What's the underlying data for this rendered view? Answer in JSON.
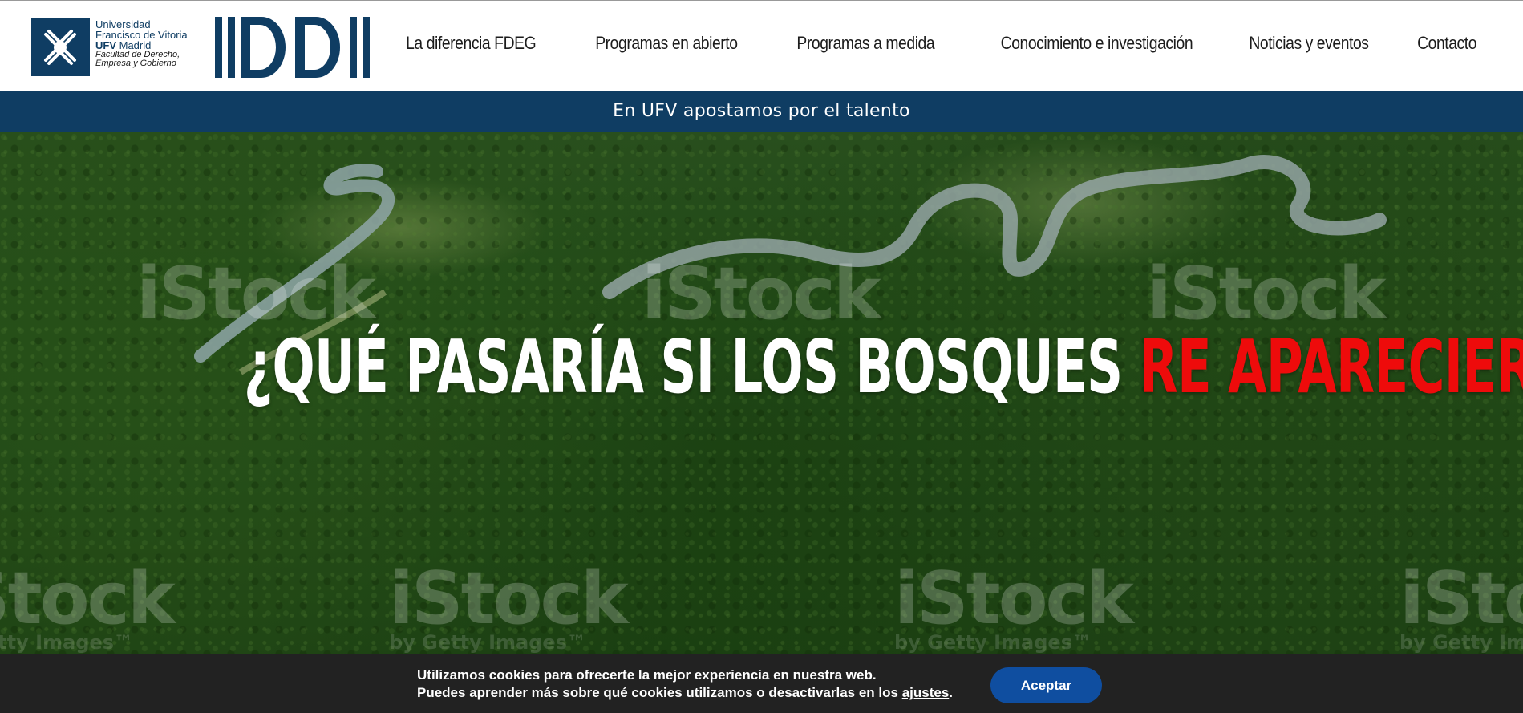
{
  "header": {
    "logo": {
      "line1": "Universidad",
      "line2": "Francisco de Vitoria",
      "line3_bold": "UFV",
      "line3_rest": " Madrid",
      "line4": "Facultad de Derecho,",
      "line5": "Empresa y Gobierno"
    },
    "nav": [
      {
        "label": "La diferencia FDEG"
      },
      {
        "label": "Programas en abierto"
      },
      {
        "label": "Programas a medida"
      },
      {
        "label": "Conocimiento e investigación"
      },
      {
        "label": "Noticias y eventos"
      },
      {
        "label": "Contacto"
      }
    ]
  },
  "banner": {
    "text": "En UFV apostamos por el talento"
  },
  "hero": {
    "title_part1": "¿QUÉ PASARÍA SI LOS BOSQUES ",
    "title_highlight": "RE APARECIERAN?",
    "watermark_text": "iStock",
    "watermark_sub": "by Getty Images™"
  },
  "cookie": {
    "line1": "Utilizamos cookies para ofrecerte la mejor experiencia en nuestra web.",
    "line2_before": "Puedes aprender más sobre qué cookies utilizamos o desactivarlas en los ",
    "line2_link": "ajustes",
    "line2_after": ".",
    "accept_label": "Aceptar"
  },
  "colors": {
    "navy": "#0f3d63",
    "accent_red": "#ee0b0b",
    "button_blue": "#0f4ea0",
    "cookie_bg": "#222222"
  }
}
